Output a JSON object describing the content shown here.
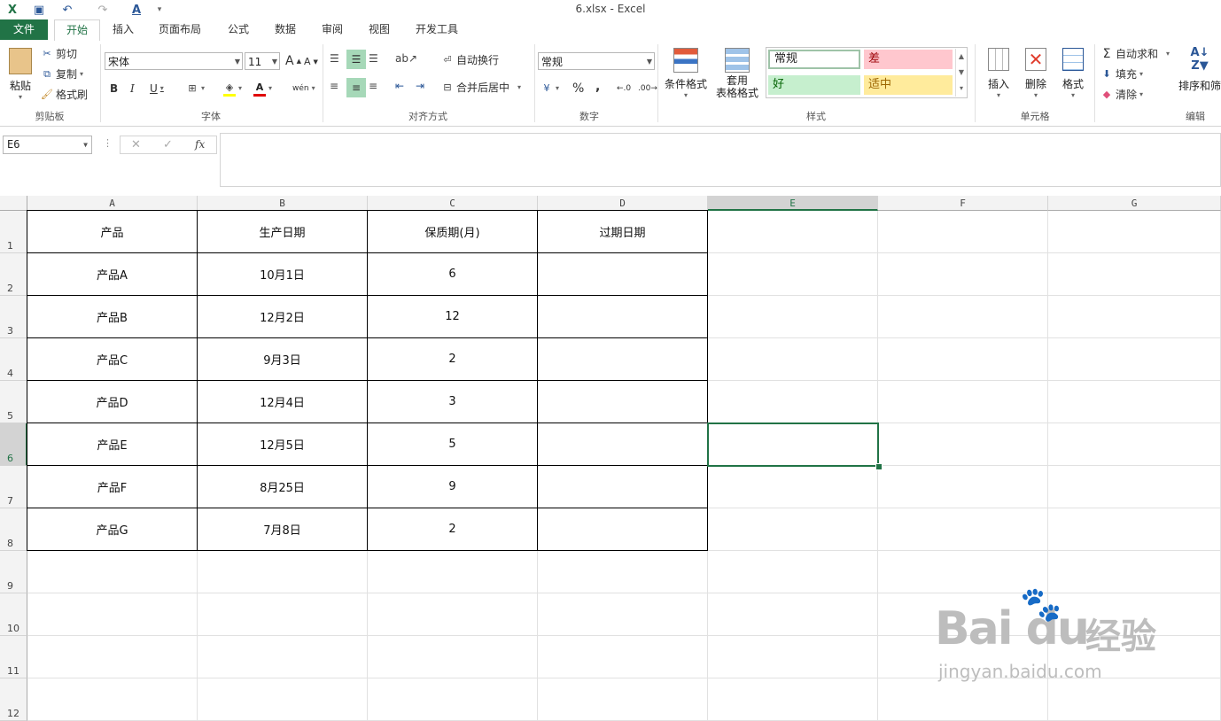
{
  "window": {
    "title": "6.xlsx - Excel"
  },
  "ribbon_tabs": [
    "文件",
    "开始",
    "插入",
    "页面布局",
    "公式",
    "数据",
    "审阅",
    "视图",
    "开发工具"
  ],
  "clipboard": {
    "paste": "粘贴",
    "cut": "剪切",
    "copy": "复制",
    "format_painter": "格式刷",
    "group": "剪贴板"
  },
  "font": {
    "name": "宋体",
    "size": "11",
    "group": "字体",
    "bold": "B",
    "italic": "I",
    "underline": "U",
    "grow": "A",
    "shrink": "A",
    "font_color_label": "A",
    "phonetic": "wén"
  },
  "alignment": {
    "wrap": "自动换行",
    "merge": "合并后居中",
    "group": "对齐方式"
  },
  "number": {
    "format": "常规",
    "group": "数字",
    "percent": "%",
    "comma": ","
  },
  "styles": {
    "conditional": "条件格式",
    "table_fmt_1": "套用",
    "table_fmt_2": "表格格式",
    "normal": "常规",
    "bad": "差",
    "good": "好",
    "neutral": "适中",
    "group": "样式"
  },
  "cells": {
    "insert": "插入",
    "delete": "删除",
    "format": "格式",
    "group": "单元格"
  },
  "editing": {
    "autosum": "自动求和",
    "fill": "填充",
    "clear": "清除",
    "sort": "排序和筛",
    "group": "编辑"
  },
  "formula_bar": {
    "name_box": "E6",
    "fx": "fx",
    "content": ""
  },
  "columns": [
    "A",
    "B",
    "C",
    "D",
    "E",
    "F",
    "G"
  ],
  "rows": [
    "1",
    "2",
    "3",
    "4",
    "5",
    "6",
    "7",
    "8",
    "9",
    "10",
    "11",
    "12"
  ],
  "table": {
    "headers": [
      "产品",
      "生产日期",
      "保质期(月)",
      "过期日期"
    ],
    "data": [
      [
        "产品A",
        "10月1日",
        "6",
        ""
      ],
      [
        "产品B",
        "12月2日",
        "12",
        ""
      ],
      [
        "产品C",
        "9月3日",
        "2",
        ""
      ],
      [
        "产品D",
        "12月4日",
        "3",
        ""
      ],
      [
        "产品E",
        "12月5日",
        "5",
        ""
      ],
      [
        "产品F",
        "8月25日",
        "9",
        ""
      ],
      [
        "产品G",
        "7月8日",
        "2",
        ""
      ]
    ]
  },
  "selected_cell": "E6",
  "watermark": {
    "brand": "Bai  du",
    "sub": "经验",
    "url": "jingyan.baidu.com"
  },
  "colors": {
    "excel_green": "#217346",
    "bad_bg": "#ffc7ce",
    "good_bg": "#c6efce",
    "neutral_bg": "#ffeb9c"
  }
}
